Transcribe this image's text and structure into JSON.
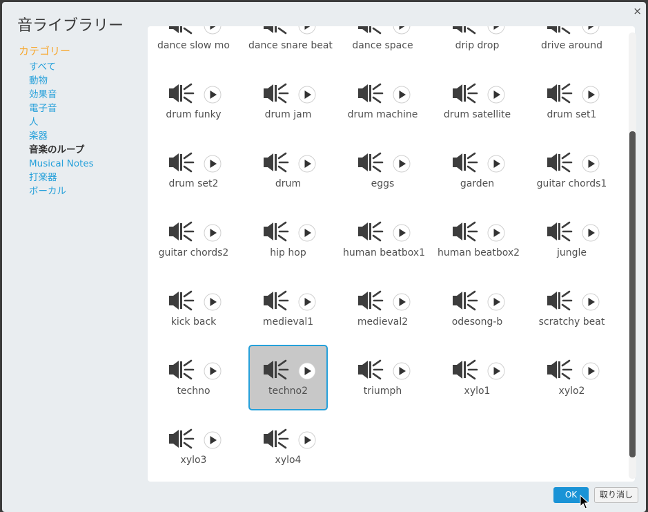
{
  "dialog": {
    "title": "音ライブラリー",
    "close_symbol": "×",
    "ok_label": "OK",
    "cancel_label": "取り消し"
  },
  "sidebar": {
    "heading": "カテゴリー",
    "items": [
      "すべて",
      "動物",
      "効果音",
      "電子音",
      "人",
      "楽器",
      "音楽のループ",
      "Musical Notes",
      "打楽器",
      "ボーカル"
    ],
    "active_index": 6
  },
  "icons": {
    "sound": "speaker-icon",
    "play": "play-icon"
  },
  "colors": {
    "accent": "#25a0da",
    "category_heading": "#f7a830",
    "ok_button": "#1a93d6",
    "selected_tile": "#c8c8c8"
  },
  "sounds": [
    "dance slow mo",
    "dance snare beat",
    "dance space",
    "drip drop",
    "drive around",
    "drum funky",
    "drum jam",
    "drum machine",
    "drum satellite",
    "drum set1",
    "drum set2",
    "drum",
    "eggs",
    "garden",
    "guitar chords1",
    "guitar chords2",
    "hip hop",
    "human beatbox1",
    "human beatbox2",
    "jungle",
    "kick back",
    "medieval1",
    "medieval2",
    "odesong-b",
    "scratchy beat",
    "techno",
    "techno2",
    "triumph",
    "xylo1",
    "xylo2",
    "xylo3",
    "xylo4"
  ],
  "selected_sound": "techno2",
  "scroll": {
    "position_fraction": 0.82,
    "visible_fraction": 0.73
  }
}
